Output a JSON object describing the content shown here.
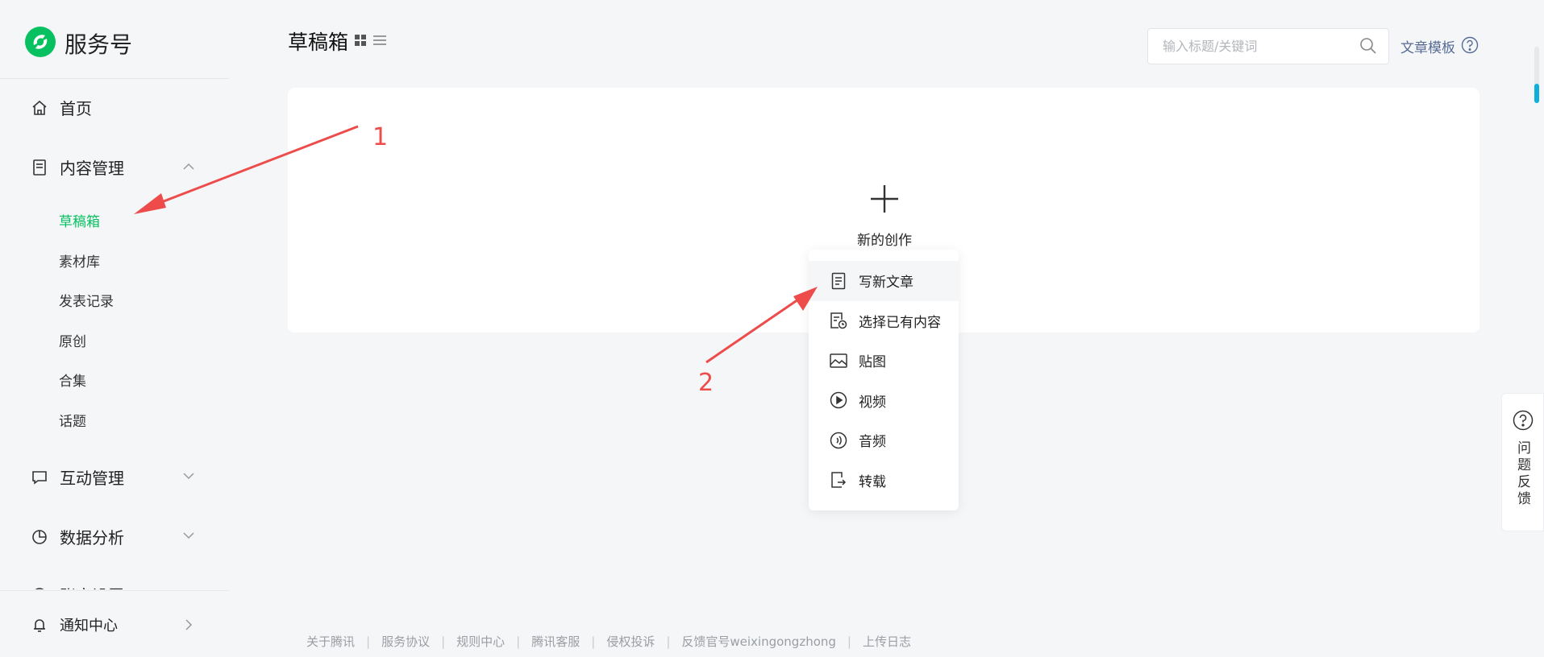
{
  "brand": {
    "name": "服务号",
    "green": "#07c160",
    "link_color": "#576b95"
  },
  "sidebar": {
    "home": "首页",
    "content_mgmt": "内容管理",
    "content_sub": [
      "草稿箱",
      "素材库",
      "发表记录",
      "原创",
      "合集",
      "话题"
    ],
    "interaction_mgmt": "互动管理",
    "data_analysis": "数据分析",
    "partial_item": "账户设置",
    "notification": "通知中心"
  },
  "header": {
    "title": "草稿箱",
    "search_placeholder": "输入标题/关键词",
    "template_link": "文章模板"
  },
  "card": {
    "new_create": "新的创作"
  },
  "menu": {
    "items": [
      "写新文章",
      "选择已有内容",
      "贴图",
      "视频",
      "音频",
      "转载"
    ]
  },
  "annotations": {
    "label_1": "1",
    "label_2": "2",
    "color": "#ee4b4b"
  },
  "footer": {
    "links": [
      "关于腾讯",
      "服务协议",
      "规则中心",
      "腾讯客服",
      "侵权投诉",
      "反馈官号weixingongzhong",
      "上传日志"
    ]
  },
  "feedback": {
    "label": "问题反馈"
  }
}
